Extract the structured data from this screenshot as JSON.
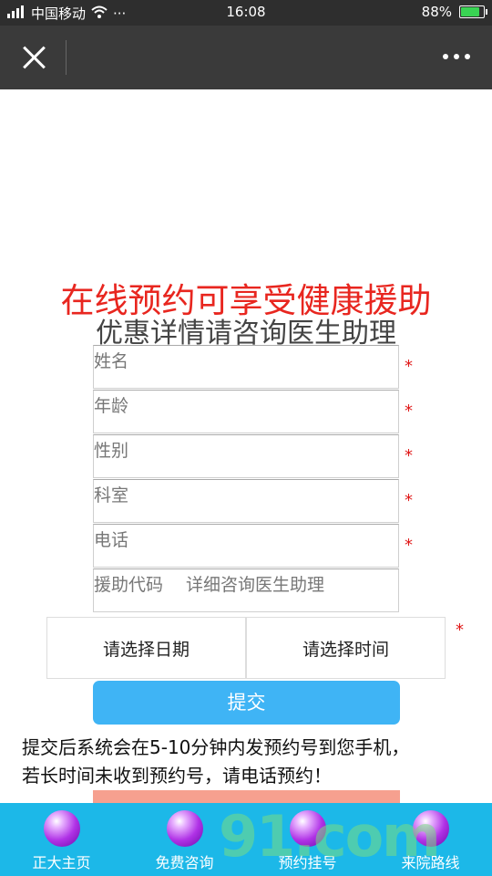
{
  "status_bar": {
    "carrier": "中国移动",
    "dots": "···",
    "time": "16:08",
    "battery": "88%"
  },
  "headline": "在线预约可享受健康援助",
  "subheadline": "优惠详情请咨询医生助理",
  "form": {
    "fields": [
      {
        "placeholder": "姓名",
        "required_mark": "*"
      },
      {
        "placeholder": "年龄",
        "required_mark": "*"
      },
      {
        "placeholder": "性别",
        "required_mark": "*"
      },
      {
        "placeholder": "科室",
        "required_mark": "*"
      },
      {
        "placeholder": "电话",
        "required_mark": "*"
      },
      {
        "placeholder": "援助代码　 详细咨询医生助理",
        "required_mark": ""
      }
    ],
    "date_label": "请选择日期",
    "time_label": "请选择时间",
    "date_required_mark": "*",
    "submit_label": "提交"
  },
  "notice_line1": "提交后系统会在5-10分钟内发预约号到您手机，",
  "notice_line2": "若长时间未收到预约号，请电话预约！",
  "bottom_nav": [
    {
      "label": "正大主页"
    },
    {
      "label": "免费咨询"
    },
    {
      "label": "预约挂号"
    },
    {
      "label": "来院路线"
    }
  ],
  "watermark": "91.com",
  "colors": {
    "headline": "#e8261f",
    "submit": "#3fb4f5",
    "bottom_bar": "#1cb8e8"
  }
}
